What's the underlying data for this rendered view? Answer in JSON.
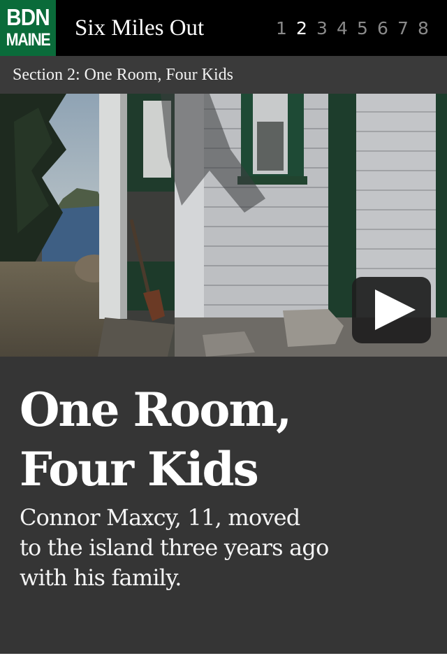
{
  "header": {
    "logo_line1": "BDN",
    "logo_line2": "MAINE",
    "site_title": "Six Miles Out",
    "pages": [
      "1",
      "2",
      "3",
      "4",
      "5",
      "6",
      "7",
      "8"
    ],
    "active_page": "2"
  },
  "section": {
    "label": "Section 2: One Room, Four Kids"
  },
  "media": {
    "play_icon": "play-icon"
  },
  "story": {
    "title_line1": "One Room,",
    "title_line2": "Four Kids",
    "dek_line1": "Connor Maxcy, 11, moved",
    "dek_line2": "to the island three years ago",
    "dek_line3": "with his family."
  },
  "colors": {
    "brand_green": "#0a6b3a",
    "header_bg": "#000000",
    "section_bg": "#3a3a3a",
    "story_bg": "#353535"
  }
}
